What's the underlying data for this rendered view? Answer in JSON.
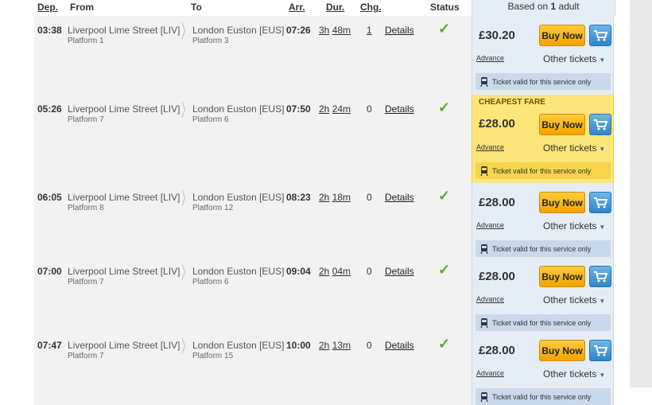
{
  "header": {
    "dep": "Dep.",
    "from": "From",
    "to": "To",
    "arr": "Arr.",
    "dur": "Dur.",
    "chg": "Chg.",
    "status": "Status",
    "based_prefix": "Based on ",
    "based_count": "1",
    "based_suffix": " adult"
  },
  "labels": {
    "details": "Details",
    "buy_now": "Buy Now",
    "advance": "Advance",
    "other_tickets": "Other tickets",
    "ticket_valid": "Ticket valid for this service only",
    "cheapest_fare": "CHEAPEST FARE"
  },
  "rows": [
    {
      "dep": "03:38",
      "from": "Liverpool Lime Street [LIV]",
      "from_platform": "Platform 1",
      "to": "London Euston [EUS]",
      "to_platform": "Platform 3",
      "arr": "07:26",
      "dur_h": "3h",
      "dur_m": "48m",
      "chg": "1",
      "price": "£30.20",
      "status": "✓"
    },
    {
      "dep": "05:26",
      "from": "Liverpool Lime Street [LIV]",
      "from_platform": "Platform 7",
      "to": "London Euston [EUS]",
      "to_platform": "Platform 6",
      "arr": "07:50",
      "dur_h": "2h",
      "dur_m": "24m",
      "chg": "0",
      "price": "£28.00",
      "status": "✓"
    },
    {
      "dep": "06:05",
      "from": "Liverpool Lime Street [LIV]",
      "from_platform": "Platform 8",
      "to": "London Euston [EUS]",
      "to_platform": "Platform 12",
      "arr": "08:23",
      "dur_h": "2h",
      "dur_m": "18m",
      "chg": "0",
      "price": "£28.00",
      "status": "✓"
    },
    {
      "dep": "07:00",
      "from": "Liverpool Lime Street [LIV]",
      "from_platform": "Platform 7",
      "to": "London Euston [EUS]",
      "to_platform": "Platform 6",
      "arr": "09:04",
      "dur_h": "2h",
      "dur_m": "04m",
      "chg": "0",
      "price": "£28.00",
      "status": "✓"
    },
    {
      "dep": "07:47",
      "from": "Liverpool Lime Street [LIV]",
      "from_platform": "Platform 7",
      "to": "London Euston [EUS]",
      "to_platform": "Platform 15",
      "arr": "10:00",
      "dur_h": "2h",
      "dur_m": "13m",
      "chg": "0",
      "price": "£28.00",
      "status": "✓"
    }
  ],
  "colors": {
    "fare_bg": "#e4edf6",
    "cheapest_bg": "#fde57a",
    "buy_button": "#f3a400",
    "cart_button": "#2d85cc",
    "status_check": "#5aa91e"
  },
  "icons": {
    "cart": "cart-icon",
    "train": "train-icon",
    "chevron": "chevron-right-icon",
    "status": "check-icon",
    "dropdown": "chevron-down-icon"
  }
}
